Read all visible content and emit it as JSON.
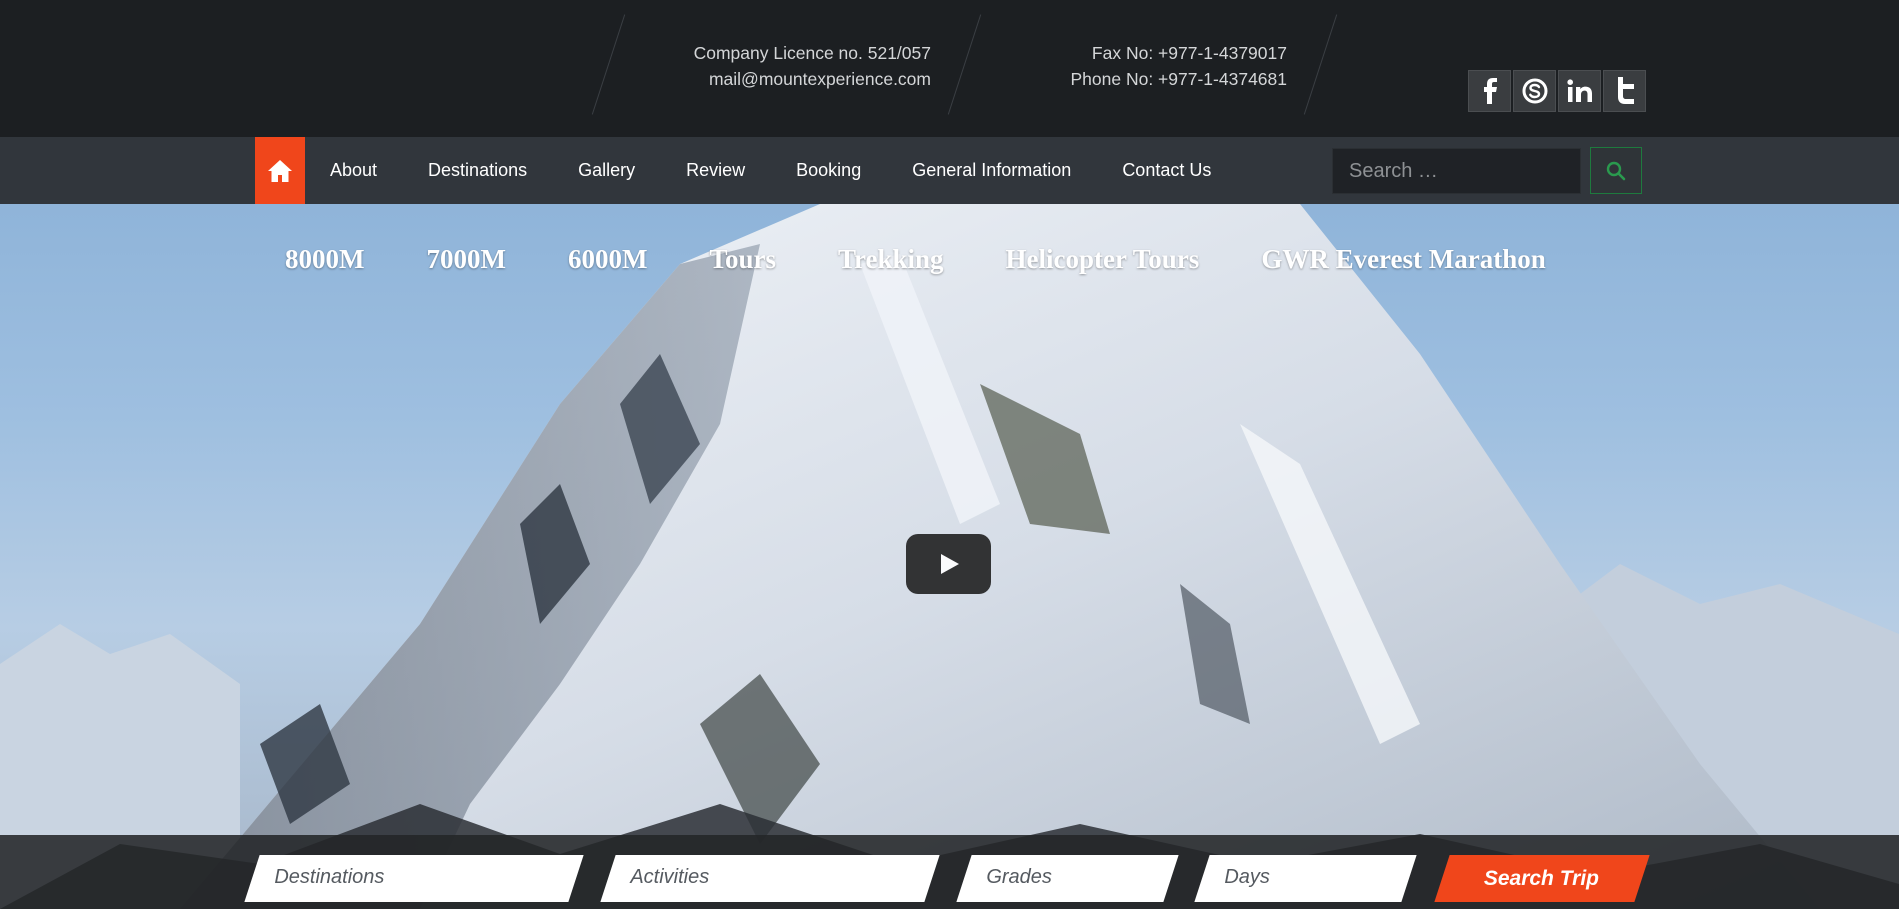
{
  "header": {
    "licence": "Company Licence no. 521/057",
    "email": "mail@mountexperience.com",
    "fax": "Fax No: +977-1-4379017",
    "phone": "Phone No: +977-1-4374681",
    "social": [
      {
        "icon": "facebook-icon",
        "glyph": "f"
      },
      {
        "icon": "skype-icon",
        "glyph": "S"
      },
      {
        "icon": "linkedin-icon",
        "glyph": "in"
      },
      {
        "icon": "twitter-icon",
        "glyph": "t"
      }
    ]
  },
  "nav": {
    "home_icon": "home-icon",
    "items": [
      "About",
      "Destinations",
      "Gallery",
      "Review",
      "Booking",
      "General Information",
      "Contact Us"
    ],
    "search_placeholder": "Search …",
    "search_icon": "search-icon"
  },
  "hero": {
    "categories": [
      "8000M",
      "7000M",
      "6000M",
      "Tours",
      "Trekking",
      "Helicopter Tours",
      "GWR Everest Marathon"
    ],
    "play_icon": "play-icon"
  },
  "trip_search": {
    "destinations": "Destinations",
    "activities": "Activities",
    "grades": "Grades",
    "days": "Days",
    "button": "Search Trip"
  },
  "colors": {
    "accent": "#f0461b",
    "topbar": "#1c1f22",
    "navbar": "#31363c",
    "search_border": "#1e7a3e"
  }
}
